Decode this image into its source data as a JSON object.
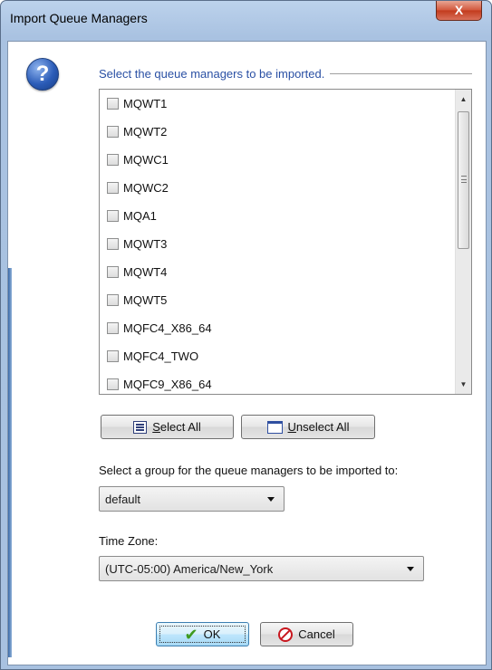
{
  "window": {
    "title": "Import Queue Managers",
    "close_label": "X"
  },
  "dialog": {
    "icon": "question-icon",
    "header": "Select the queue managers to be imported.",
    "queue_managers": [
      {
        "label": "MQWT1",
        "checked": false
      },
      {
        "label": "MQWT2",
        "checked": false
      },
      {
        "label": "MQWC1",
        "checked": false
      },
      {
        "label": "MQWC2",
        "checked": false
      },
      {
        "label": "MQA1",
        "checked": false
      },
      {
        "label": "MQWT3",
        "checked": false
      },
      {
        "label": "MQWT4",
        "checked": false
      },
      {
        "label": "MQWT5",
        "checked": false
      },
      {
        "label": "MQFC4_X86_64",
        "checked": false
      },
      {
        "label": "MQFC4_TWO",
        "checked": false
      },
      {
        "label": "MQFC9_X86_64",
        "checked": false
      }
    ],
    "select_all": {
      "first": "S",
      "rest": "elect All"
    },
    "unselect_all": {
      "first": "U",
      "rest": "nselect All"
    },
    "group_label": "Select a group for the queue managers to be imported to:",
    "group_value": "default",
    "timezone_label": "Time Zone:",
    "timezone_value": "(UTC-05:00) America/New_York",
    "ok_label": "OK",
    "cancel_label": "Cancel"
  }
}
